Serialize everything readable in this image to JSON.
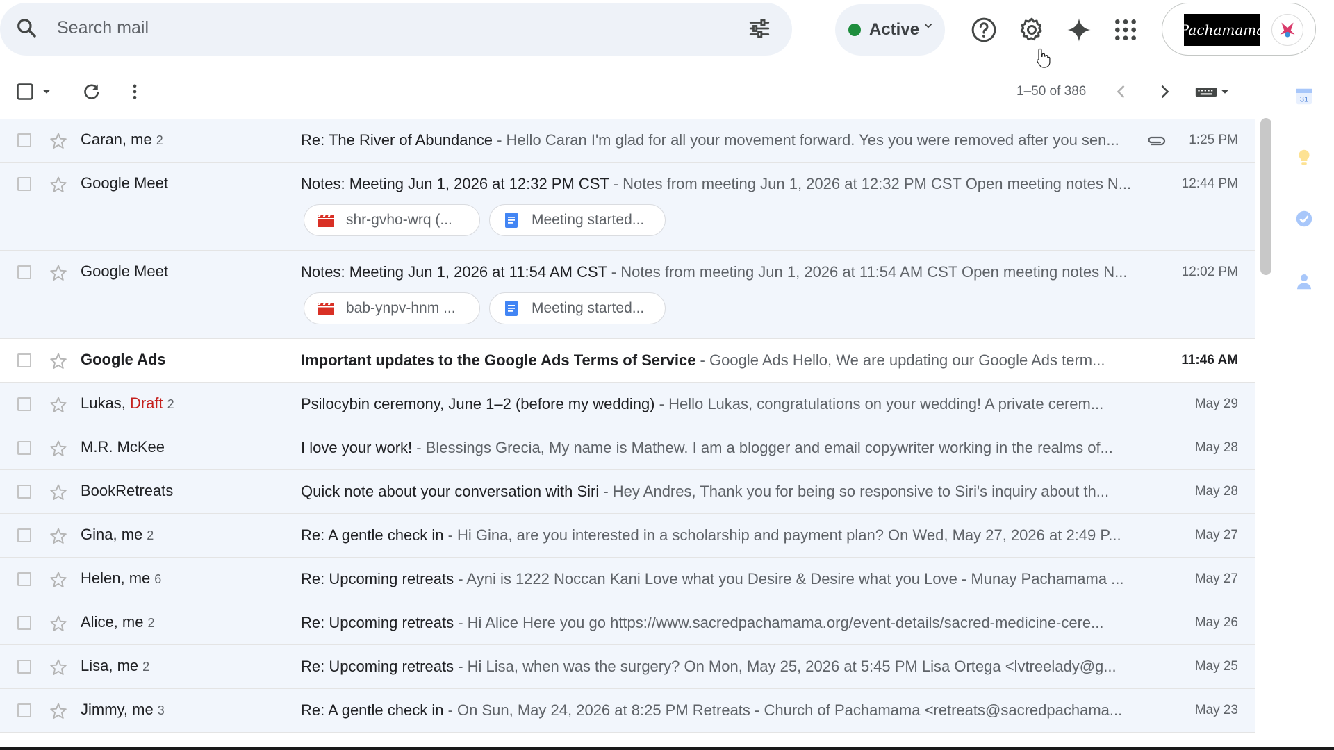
{
  "search": {
    "placeholder": "Search mail"
  },
  "status": {
    "label": "Active",
    "color": "#1e8e3e"
  },
  "account": {
    "logo_text": "Pachamama"
  },
  "toolbar": {
    "pager": "1–50 of 386"
  },
  "emails": [
    {
      "sender": "Caran, me",
      "count": "2",
      "subject": "Re: The River of Abundance",
      "snippet": " - Hello Caran I'm glad for all your movement forward. Yes you were removed after you sen...",
      "date": "1:25 PM",
      "unread": false,
      "attachment": true
    },
    {
      "sender": "Google Meet",
      "subject": "Notes: Meeting Jun 1, 2026 at 12:32 PM CST",
      "snippet": " - Notes from meeting Jun 1, 2026 at 12:32 PM CST Open meeting notes N...",
      "date": "12:44 PM",
      "chips": [
        "shr-gvho-wrq (...",
        "Meeting started..."
      ]
    },
    {
      "sender": "Google Meet",
      "subject": "Notes: Meeting Jun 1, 2026 at 11:54 AM CST",
      "snippet": " - Notes from meeting Jun 1, 2026 at 11:54 AM CST Open meeting notes N...",
      "date": "12:02 PM",
      "chips": [
        "bab-ynpv-hnm ...",
        "Meeting started..."
      ]
    },
    {
      "sender": "Google Ads",
      "subject": "Important updates to the Google Ads Terms of Service",
      "snippet": " - Google Ads Hello, We are updating our Google Ads term...",
      "date": "11:46 AM",
      "unread": true
    },
    {
      "sender": "Lukas, ",
      "draft": "Draft",
      "count": "2",
      "subject": "Psilocybin ceremony, June 1–2 (before my wedding)",
      "snippet": " - Hello Lukas, congratulations on your wedding! A private cerem...",
      "date": "May 29"
    },
    {
      "sender": "M.R. McKee",
      "subject": "I love your work!",
      "snippet": " - Blessings Grecia, My name is Mathew. I am a blogger and email copywriter working in the realms of...",
      "date": "May 28"
    },
    {
      "sender": "BookRetreats",
      "subject": "Quick note about your conversation with Siri",
      "snippet": " - Hey Andres, Thank you for being so responsive to Siri's inquiry about th...",
      "date": "May 28"
    },
    {
      "sender": "Gina, me",
      "count": "2",
      "subject": "Re: A gentle check in",
      "snippet": " - Hi Gina, are you interested in a scholarship and payment plan? On Wed, May 27, 2026 at 2:49 P...",
      "date": "May 27"
    },
    {
      "sender": "Helen, me",
      "count": "6",
      "subject": "Re: Upcoming retreats",
      "snippet": " - Ayni is 1222 Noccan Kani Love what you Desire & Desire what you Love - Munay Pachamama ...",
      "date": "May 27"
    },
    {
      "sender": "Alice, me",
      "count": "2",
      "subject": "Re: Upcoming retreats",
      "snippet": " - Hi Alice Here you go https://www.sacredpachamama.org/event-details/sacred-medicine-cere...",
      "date": "May 26"
    },
    {
      "sender": "Lisa, me",
      "count": "2",
      "subject": "Re: Upcoming retreats",
      "snippet": " - Hi Lisa, when was the surgery? On Mon, May 25, 2026 at 5:45 PM Lisa Ortega <lvtreelady@g...",
      "date": "May 25"
    },
    {
      "sender": "Jimmy, me",
      "count": "3",
      "subject": "Re: A gentle check in",
      "snippet": " - On Sun, May 24, 2026 at 8:25 PM Retreats - Church of Pachamama <retreats@sacredpachama...",
      "date": "May 23"
    }
  ]
}
